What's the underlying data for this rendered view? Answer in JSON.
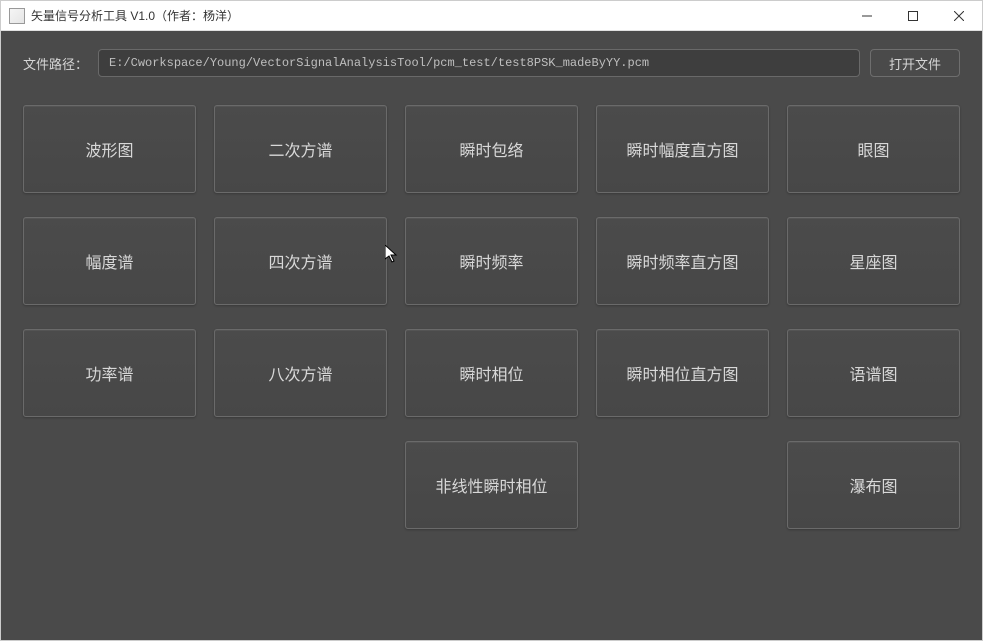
{
  "window": {
    "title": "矢量信号分析工具 V1.0（作者：杨洋）"
  },
  "file_row": {
    "label": "文件路径：",
    "value": "E:/Cworkspace/Young/VectorSignalAnalysisTool/pcm_test/test8PSK_madeByYY.pcm",
    "open_label": "打开文件"
  },
  "grid": {
    "r0c0": "波形图",
    "r0c1": "二次方谱",
    "r0c2": "瞬时包络",
    "r0c3": "瞬时幅度直方图",
    "r0c4": "眼图",
    "r1c0": "幅度谱",
    "r1c1": "四次方谱",
    "r1c2": "瞬时频率",
    "r1c3": "瞬时频率直方图",
    "r1c4": "星座图",
    "r2c0": "功率谱",
    "r2c1": "八次方谱",
    "r2c2": "瞬时相位",
    "r2c3": "瞬时相位直方图",
    "r2c4": "语谱图",
    "r3c2": "非线性瞬时相位",
    "r3c4": "瀑布图"
  }
}
